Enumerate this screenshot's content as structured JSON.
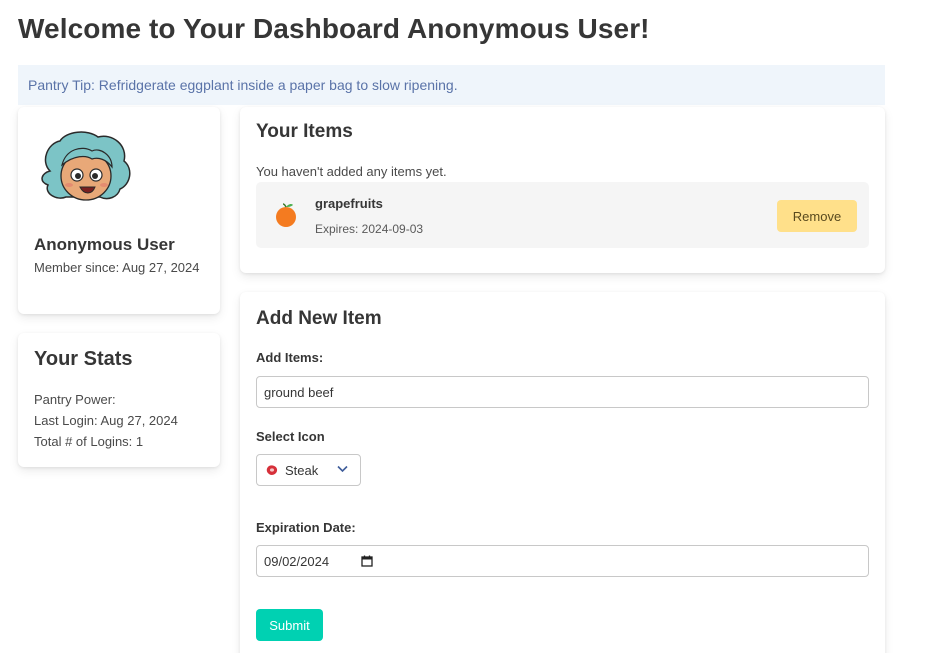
{
  "header": {
    "title": "Welcome to Your Dashboard Anonymous User!"
  },
  "tip": {
    "text": "Pantry Tip: Refridgerate eggplant inside a paper bag to slow ripening."
  },
  "profile": {
    "name": "Anonymous User",
    "member_since": "Member since: Aug 27, 2024",
    "avatar_icon": "avatar-cartoon-girl"
  },
  "stats": {
    "title": "Your Stats",
    "pantry_power": "Pantry Power:",
    "last_login": "Last Login: Aug 27, 2024",
    "total_logins": "Total # of Logins: 1"
  },
  "items": {
    "title": "Your Items",
    "empty_message": "You haven't added any items yet.",
    "list": [
      {
        "name": "grapefruits",
        "expires": "Expires: 2024-09-03",
        "icon": "orange-fruit-icon",
        "remove_label": "Remove"
      }
    ]
  },
  "add_item": {
    "title": "Add New Item",
    "items_label": "Add Items:",
    "items_value": "ground beef",
    "icon_label": "Select Icon",
    "icon_selected": "Steak",
    "date_label": "Expiration Date:",
    "date_value": "09/02/2024",
    "submit_label": "Submit"
  },
  "colors": {
    "accent": "#00d1b2",
    "warning": "#ffe08a",
    "tip_bg": "#eff5fb",
    "tip_text": "#5a73a8"
  }
}
